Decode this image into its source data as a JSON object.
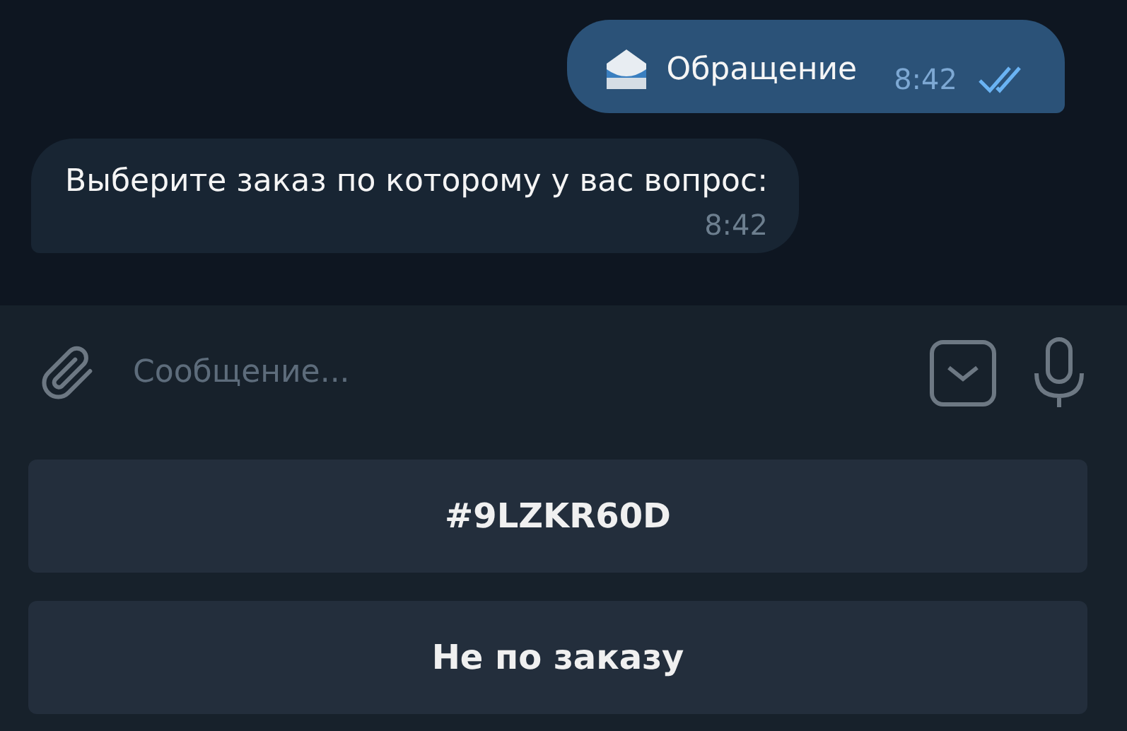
{
  "messages": [
    {
      "kind": "outgoing",
      "text": "Обращение",
      "time": "8:42",
      "read": true
    },
    {
      "kind": "incoming",
      "text": "Выберите заказ по которому у вас вопрос:",
      "time": "8:42"
    }
  ],
  "composer": {
    "placeholder": "Сообщение..."
  },
  "keyboard": [
    {
      "label": "#9LZKR60D"
    },
    {
      "label": "Не по заказу"
    }
  ]
}
